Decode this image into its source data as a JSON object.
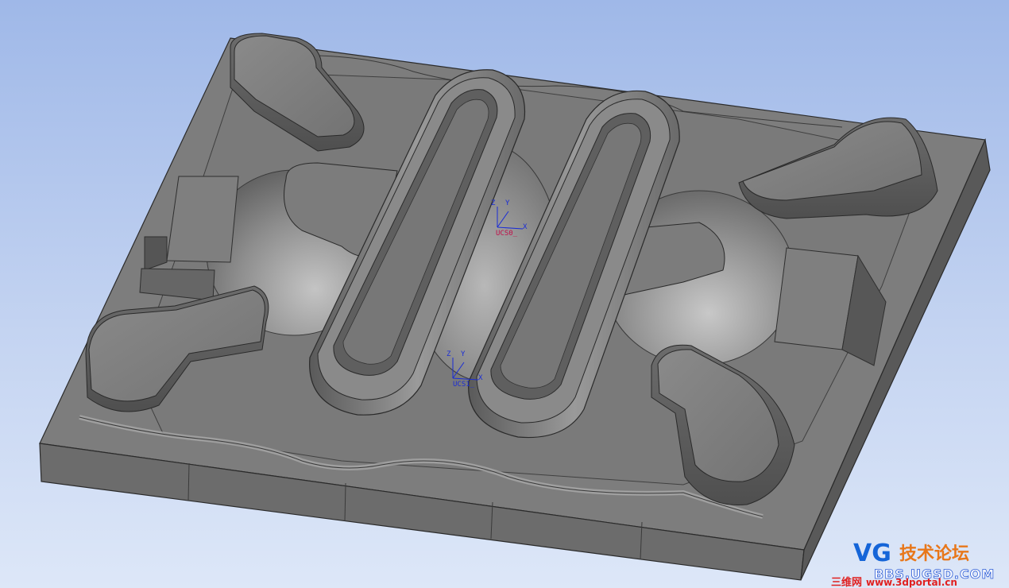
{
  "viewport": {
    "ucs_markers": [
      {
        "axis_z": "Z",
        "axis_y": "Y",
        "axis_x": "X",
        "name": "UCS0_",
        "active": true
      },
      {
        "axis_z": "Z",
        "axis_y": "Y",
        "axis_x": "X",
        "name": "UCS1_",
        "active": false
      }
    ]
  },
  "watermark": {
    "logo": "VG",
    "forum_cn": "技术论坛",
    "site": "BBS.UGSD.COM",
    "site_cn": "三维网",
    "url": "www.3dportal.cn"
  },
  "colors": {
    "background_top": "#9fb8e8",
    "background_bottom": "#dde7f8",
    "part_gray": "#7d7d7d",
    "ucs_blue": "#1a2cd6",
    "ucs_active": "#c0104a"
  }
}
